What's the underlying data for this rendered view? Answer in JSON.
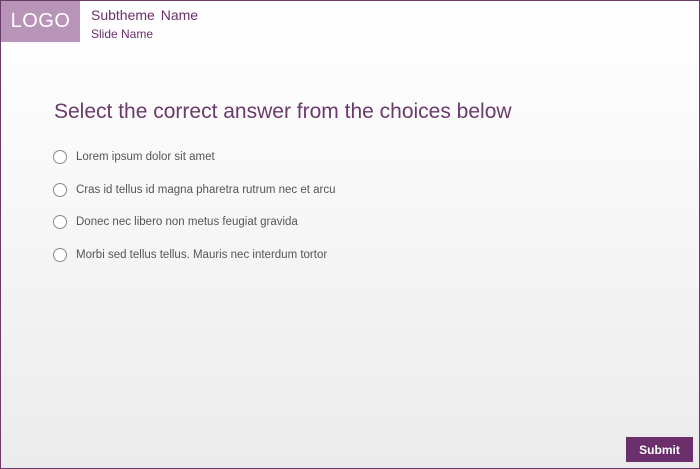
{
  "header": {
    "logo": "LOGO",
    "subtheme": "Subtheme  Name",
    "slide_name": "Slide Name"
  },
  "question": {
    "prompt": "Select the correct answer from the choices below",
    "choices": [
      {
        "label": "Lorem ipsum dolor sit amet"
      },
      {
        "label": "Cras id tellus id magna pharetra rutrum nec et arcu"
      },
      {
        "label": "Donec nec libero non metus feugiat gravida"
      },
      {
        "label": "Morbi sed tellus tellus. Mauris nec interdum tortor"
      }
    ]
  },
  "footer": {
    "submit_label": "Submit"
  },
  "colors": {
    "accent": "#6b2f6b",
    "logo_bg": "#b994b9"
  }
}
